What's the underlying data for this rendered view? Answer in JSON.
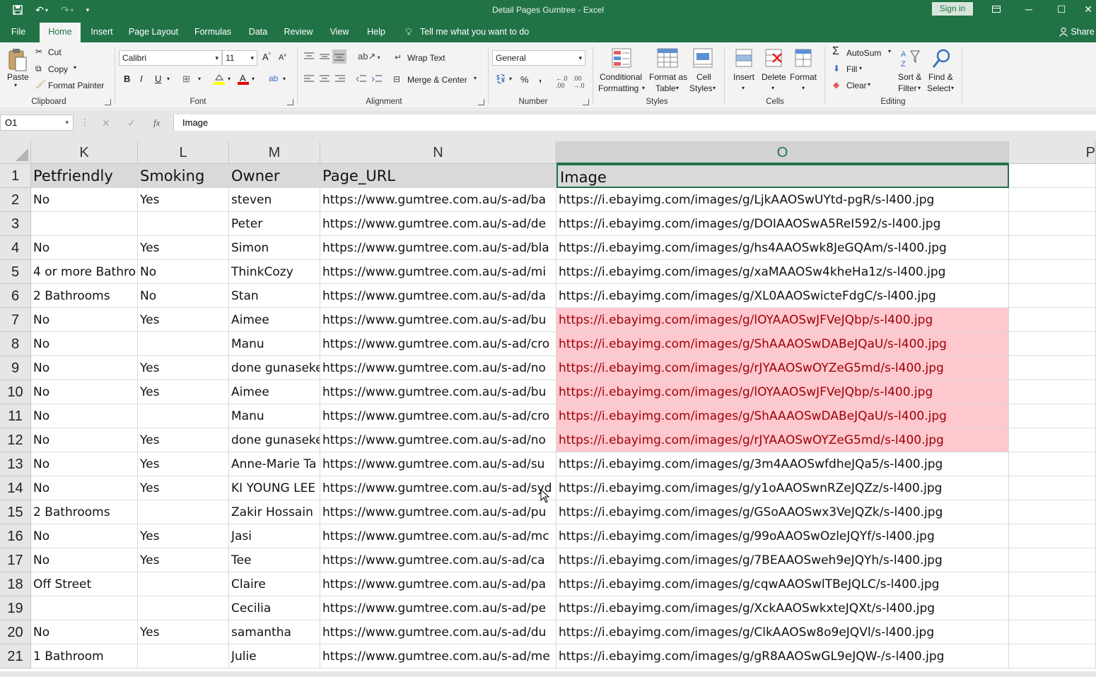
{
  "window": {
    "title": "Detail Pages Gumtree  -  Excel",
    "sign_in": "Sign in",
    "accent": "#217346"
  },
  "tabs": [
    "File",
    "Home",
    "Insert",
    "Page Layout",
    "Formulas",
    "Data",
    "Review",
    "View",
    "Help"
  ],
  "tell_me": "Tell me what you want to do",
  "share": "Share",
  "ribbon": {
    "clipboard": {
      "paste": "Paste",
      "cut": "Cut",
      "copy": "Copy",
      "format_painter": "Format Painter",
      "group": "Clipboard"
    },
    "font": {
      "name": "Calibri",
      "size": "11",
      "group": "Font",
      "bold": "B",
      "italic": "I",
      "underline": "U"
    },
    "alignment": {
      "wrap_text": "Wrap Text",
      "merge_center": "Merge & Center",
      "group": "Alignment"
    },
    "number": {
      "format": "General",
      "percent": "%",
      "comma": ",",
      "group": "Number"
    },
    "styles": {
      "conditional_1": "Conditional",
      "conditional_2": "Formatting",
      "format_table_1": "Format as",
      "format_table_2": "Table",
      "cell_styles_1": "Cell",
      "cell_styles_2": "Styles",
      "group": "Styles"
    },
    "cells": {
      "insert": "Insert",
      "delete": "Delete",
      "format": "Format",
      "group": "Cells"
    },
    "editing": {
      "autosum": "AutoSum",
      "fill": "Fill",
      "clear": "Clear",
      "sort_1": "Sort &",
      "sort_2": "Filter",
      "find_1": "Find &",
      "find_2": "Select",
      "group": "Editing"
    }
  },
  "formula_bar": {
    "name_box": "O1",
    "fx": "fx",
    "value": "Image"
  },
  "columns": [
    "K",
    "L",
    "M",
    "N",
    "O",
    "P"
  ],
  "header_row": {
    "num": "1",
    "K": "Petfriendly",
    "L": "Smoking",
    "M": "Owner",
    "N": "Page_URL",
    "O": "Image"
  },
  "rows": [
    {
      "num": "2",
      "K": "No",
      "L": "Yes",
      "M": "steven",
      "N": "https://www.gumtree.com.au/s-ad/ba",
      "O": "https://i.ebayimg.com/images/g/LjkAAOSwUYtd-pgR/s-l400.jpg",
      "dup": false
    },
    {
      "num": "3",
      "K": "",
      "L": "",
      "M": "Peter",
      "N": "https://www.gumtree.com.au/s-ad/de",
      "O": "https://i.ebayimg.com/images/g/DOIAAOSwA5ReI592/s-l400.jpg",
      "dup": false
    },
    {
      "num": "4",
      "K": "No",
      "L": "Yes",
      "M": "Simon",
      "N": "https://www.gumtree.com.au/s-ad/bla",
      "O": "https://i.ebayimg.com/images/g/hs4AAOSwk8JeGQAm/s-l400.jpg",
      "dup": false
    },
    {
      "num": "5",
      "K": "4 or more Bathro",
      "L": "No",
      "M": "ThinkCozy",
      "N": "https://www.gumtree.com.au/s-ad/mi",
      "O": "https://i.ebayimg.com/images/g/xaMAAOSw4kheHa1z/s-l400.jpg",
      "dup": false
    },
    {
      "num": "6",
      "K": "2 Bathrooms",
      "L": "No",
      "M": "Stan",
      "N": "https://www.gumtree.com.au/s-ad/da",
      "O": "https://i.ebayimg.com/images/g/XL0AAOSwicteFdgC/s-l400.jpg",
      "dup": false
    },
    {
      "num": "7",
      "K": "No",
      "L": "Yes",
      "M": "Aimee",
      "N": "https://www.gumtree.com.au/s-ad/bu",
      "O": "https://i.ebayimg.com/images/g/lOYAAOSwJFVeJQbp/s-l400.jpg",
      "dup": true
    },
    {
      "num": "8",
      "K": "No",
      "L": "",
      "M": "Manu",
      "N": "https://www.gumtree.com.au/s-ad/cro",
      "O": "https://i.ebayimg.com/images/g/ShAAAOSwDABeJQaU/s-l400.jpg",
      "dup": true
    },
    {
      "num": "9",
      "K": "No",
      "L": "Yes",
      "M": "done gunaseke",
      "N": "https://www.gumtree.com.au/s-ad/no",
      "O": "https://i.ebayimg.com/images/g/rJYAAOSwOYZeG5md/s-l400.jpg",
      "dup": true
    },
    {
      "num": "10",
      "K": "No",
      "L": "Yes",
      "M": "Aimee",
      "N": "https://www.gumtree.com.au/s-ad/bu",
      "O": "https://i.ebayimg.com/images/g/lOYAAOSwJFVeJQbp/s-l400.jpg",
      "dup": true
    },
    {
      "num": "11",
      "K": "No",
      "L": "",
      "M": "Manu",
      "N": "https://www.gumtree.com.au/s-ad/cro",
      "O": "https://i.ebayimg.com/images/g/ShAAAOSwDABeJQaU/s-l400.jpg",
      "dup": true
    },
    {
      "num": "12",
      "K": "No",
      "L": "Yes",
      "M": "done gunaseke",
      "N": "https://www.gumtree.com.au/s-ad/no",
      "O": "https://i.ebayimg.com/images/g/rJYAAOSwOYZeG5md/s-l400.jpg",
      "dup": true
    },
    {
      "num": "13",
      "K": "No",
      "L": "Yes",
      "M": "Anne-Marie Ta",
      "N": "https://www.gumtree.com.au/s-ad/su",
      "O": "https://i.ebayimg.com/images/g/3m4AAOSwfdheJQa5/s-l400.jpg",
      "dup": false
    },
    {
      "num": "14",
      "K": "No",
      "L": "Yes",
      "M": "KI YOUNG LEE",
      "N": "https://www.gumtree.com.au/s-ad/syd",
      "O": "https://i.ebayimg.com/images/g/y1oAAOSwnRZeJQZz/s-l400.jpg",
      "dup": false
    },
    {
      "num": "15",
      "K": "2 Bathrooms",
      "L": "",
      "M": "Zakir Hossain",
      "N": "https://www.gumtree.com.au/s-ad/pu",
      "O": "https://i.ebayimg.com/images/g/GSoAAOSwx3VeJQZk/s-l400.jpg",
      "dup": false
    },
    {
      "num": "16",
      "K": "No",
      "L": "Yes",
      "M": "Jasi",
      "N": "https://www.gumtree.com.au/s-ad/mc",
      "O": "https://i.ebayimg.com/images/g/99oAAOSwOzleJQYf/s-l400.jpg",
      "dup": false
    },
    {
      "num": "17",
      "K": "No",
      "L": "Yes",
      "M": "Tee",
      "N": "https://www.gumtree.com.au/s-ad/ca",
      "O": "https://i.ebayimg.com/images/g/7BEAAOSweh9eJQYh/s-l400.jpg",
      "dup": false
    },
    {
      "num": "18",
      "K": "Off Street",
      "L": "",
      "M": "Claire",
      "N": "https://www.gumtree.com.au/s-ad/pa",
      "O": "https://i.ebayimg.com/images/g/cqwAAOSwlTBeJQLC/s-l400.jpg",
      "dup": false
    },
    {
      "num": "19",
      "K": "",
      "L": "",
      "M": "Cecilia",
      "N": "https://www.gumtree.com.au/s-ad/pe",
      "O": "https://i.ebayimg.com/images/g/XckAAOSwkxteJQXt/s-l400.jpg",
      "dup": false
    },
    {
      "num": "20",
      "K": "No",
      "L": "Yes",
      "M": "samantha",
      "N": "https://www.gumtree.com.au/s-ad/du",
      "O": "https://i.ebayimg.com/images/g/ClkAAOSw8o9eJQVl/s-l400.jpg",
      "dup": false
    },
    {
      "num": "21",
      "K": "1 Bathroom",
      "L": "",
      "M": "Julie",
      "N": "https://www.gumtree.com.au/s-ad/me",
      "O": "https://i.ebayimg.com/images/g/gR8AAOSwGL9eJQW-/s-l400.jpg",
      "dup": false
    }
  ],
  "duplicate_highlight": {
    "fill": "#ffc7ce",
    "text": "#9c0006"
  }
}
